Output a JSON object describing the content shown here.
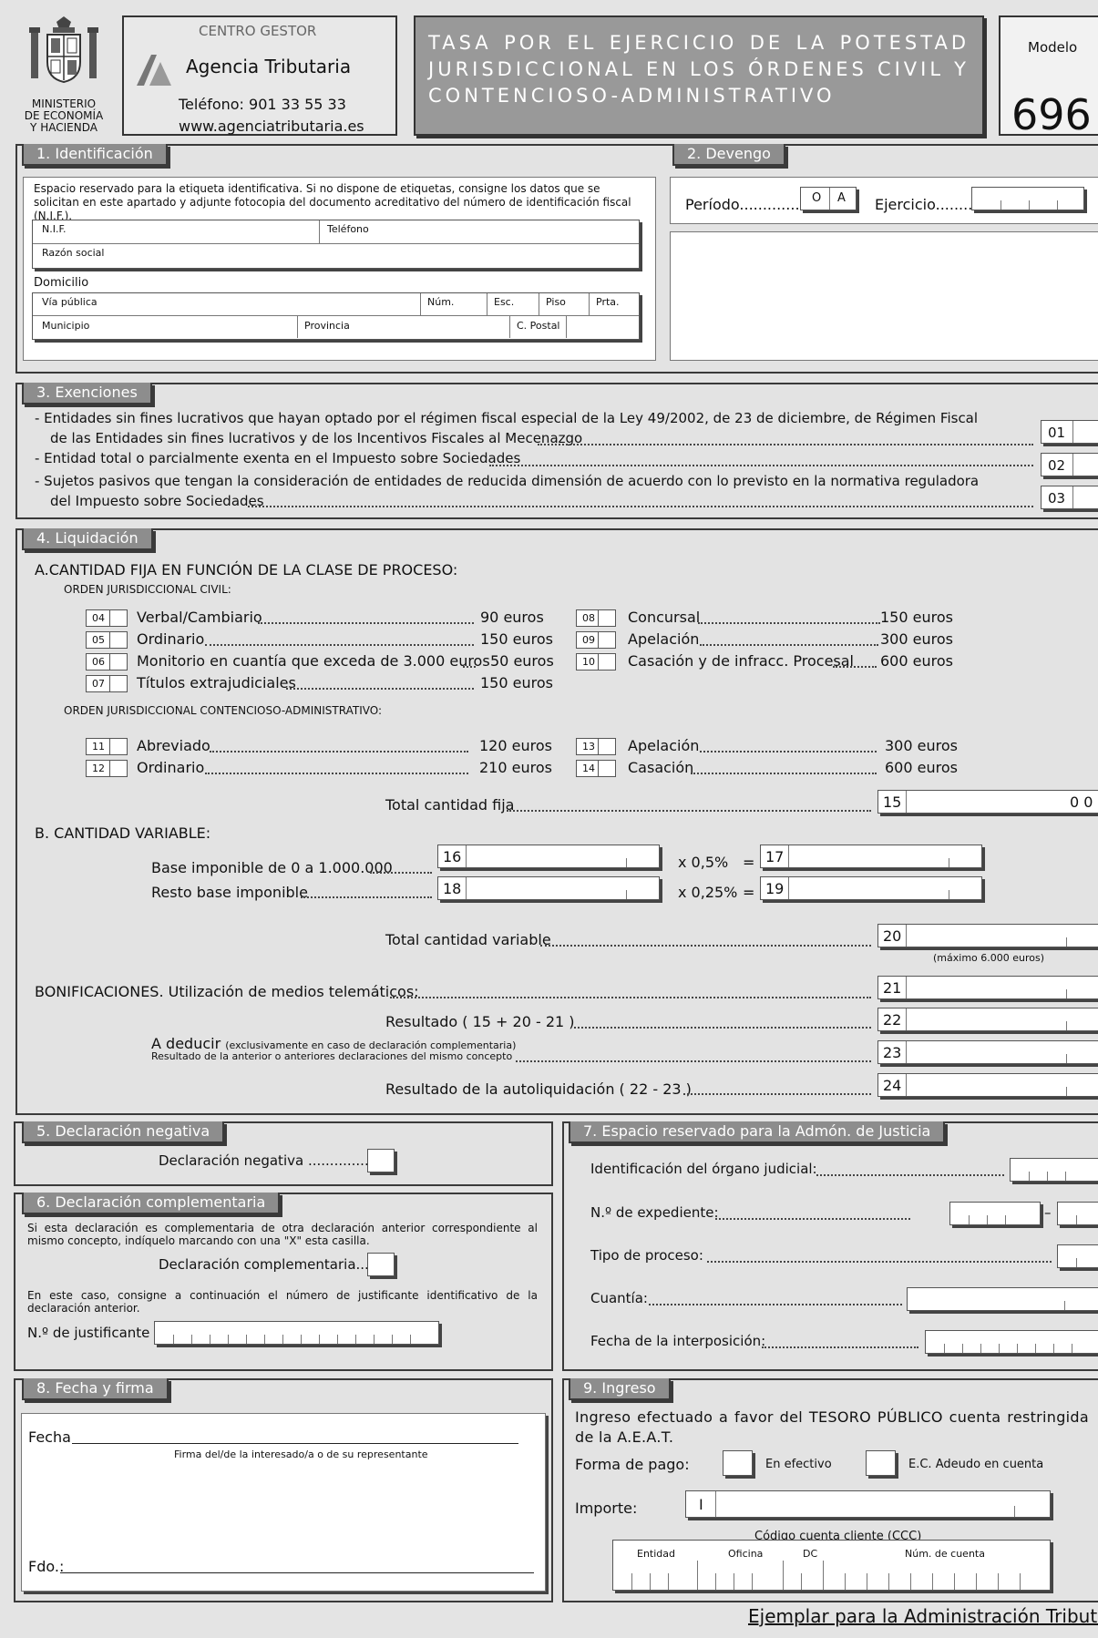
{
  "header": {
    "ministry": [
      "MINISTERIO",
      "DE ECONOMÍA",
      "Y HACIENDA"
    ],
    "centro_gestor": "CENTRO GESTOR",
    "agency_name": "Agencia Tributaria",
    "telefono": "Teléfono: 901 33 55 33",
    "web": "www.agenciatributaria.es",
    "title": "TASA POR EL EJERCICIO DE LA POTESTAD JURISDICCIONAL EN LOS ÓRDENES CIVIL Y CONTENCIOSO-ADMINISTRATIVO",
    "modelo_label": "Modelo",
    "modelo_number": "696"
  },
  "s1": {
    "tab": "1.  Identificación",
    "note": "Espacio reservado para la etiqueta identificativa. Si no dispone de etiquetas, consigne los datos que se solicitan en este apartado y adjunte fotocopia del documento acreditativo del número de identificación fiscal (N.I.F.).",
    "nif": "N.I.F.",
    "telefono": "Teléfono",
    "razon": "Razón social",
    "domicilio": "Domicilio",
    "via": "Vía pública",
    "num": "Núm.",
    "esc": "Esc.",
    "piso": "Piso",
    "prta": "Prta.",
    "municipio": "Municipio",
    "provincia": "Provincia",
    "cpostal": "C. Postal"
  },
  "s2": {
    "tab": "2.  Devengo",
    "periodo": "Período",
    "periodo_value_o": "O",
    "periodo_value_a": "A",
    "ejercicio": "Ejercicio"
  },
  "s3": {
    "tab": "3.  Exenciones",
    "items": [
      {
        "line1": "-  Entidades sin fines lucrativos que hayan optado por el régimen fiscal especial de la Ley 49/2002, de 23 de diciembre, de Régimen Fiscal",
        "line2": "de las Entidades sin fines lucrativos y de los Incentivos Fiscales al Mecenazgo",
        "code": "01"
      },
      {
        "line1": "-  Entidad total o parcialmente exenta en el Impuesto sobre Sociedades",
        "line2": "",
        "code": "02"
      },
      {
        "line1": "-  Sujetos pasivos que tengan la consideración de entidades de reducida dimensión de acuerdo con lo previsto en la normativa reguladora",
        "line2": "del Impuesto sobre Sociedades",
        "code": "03"
      }
    ]
  },
  "s4": {
    "tab": "4.  Liquidación",
    "a_title": "A.CANTIDAD FIJA EN FUNCIÓN DE LA CLASE DE PROCESO:",
    "civil": "ORDEN JURISDICCIONAL CIVIL:",
    "contencioso": "ORDEN JURISDICCIONAL CONTENCIOSO-ADMINISTRATIVO:",
    "civil_left": [
      {
        "code": "04",
        "label": "Verbal/Cambiario",
        "amount": "90 euros"
      },
      {
        "code": "05",
        "label": "Ordinario",
        "amount": "150 euros"
      },
      {
        "code": "06",
        "label": "Monitorio en cuantía que exceda de 3.000 euros",
        "amount": "50 euros"
      },
      {
        "code": "07",
        "label": "Títulos extrajudiciales",
        "amount": "150 euros"
      }
    ],
    "civil_right": [
      {
        "code": "08",
        "label": "Concursal",
        "amount": "150 euros"
      },
      {
        "code": "09",
        "label": "Apelación",
        "amount": "300 euros"
      },
      {
        "code": "10",
        "label": "Casación y de infracc. Procesal",
        "amount": "600 euros"
      }
    ],
    "cont_left": [
      {
        "code": "11",
        "label": "Abreviado",
        "amount": "120 euros"
      },
      {
        "code": "12",
        "label": "Ordinario",
        "amount": "210 euros"
      }
    ],
    "cont_right": [
      {
        "code": "13",
        "label": "Apelación",
        "amount": "300 euros"
      },
      {
        "code": "14",
        "label": "Casación",
        "amount": "600 euros"
      }
    ],
    "total_fija": "Total cantidad fija",
    "box15": "15",
    "box15_value": "0 0",
    "b_title": "B. CANTIDAD VARIABLE:",
    "base1": "Base imponible de 0 a 1.000.000",
    "base2": "Resto base imponible",
    "box16": "16",
    "box17": "17",
    "box18": "18",
    "box19": "19",
    "rate1": "x 0,5%",
    "rate2": "x 0,25%",
    "eq": "=",
    "total_var": "Total cantidad variable",
    "box20": "20",
    "maximo": "(máximo 6.000 euros)",
    "bonif": "BONIFICACIONES. Utilización de medios telemáticos:",
    "box21": "21",
    "resultado": "Resultado ( 15 + 20 - 21 )",
    "box22": "22",
    "deducir": "A deducir",
    "deducir_note": "(exclusivamente en caso de declaración complementaria)",
    "deducir_sub": "Resultado de la anterior o anteriores declaraciones del mismo concepto",
    "box23": "23",
    "autoliq": "Resultado de la autoliquidación ( 22 - 23 )",
    "box24": "24"
  },
  "s5": {
    "tab": "5.  Declaración negativa",
    "label": "Declaración negativa"
  },
  "s6": {
    "tab": "6.  Declaración complementaria",
    "note1": "Si esta declaración es complementaria de otra declaración anterior correspondiente al mismo concepto, indíquelo marcando con una \"X\" esta casilla.",
    "label": "Declaración complementaria",
    "note2": "En este caso, consigne a continuación el número de justificante identificativo de la declaración anterior.",
    "justificante": "N.º de justificante"
  },
  "s7": {
    "tab": "7.  Espacio reservado para la Admón. de Justicia",
    "organo": "Identificación del órgano judicial:",
    "expediente": "N.º de expediente:",
    "dash": "–",
    "tipo": "Tipo de proceso:",
    "cuantia": "Cuantía:",
    "fecha": "Fecha de la interposición:"
  },
  "s8": {
    "tab": "8.  Fecha y firma",
    "fecha": "Fecha",
    "firma": "Firma del/de la interesado/a o de su representante",
    "fdo": "Fdo.:"
  },
  "s9": {
    "tab": "9.  Ingreso",
    "text": "Ingreso efectuado a favor del TESORO PÚBLICO cuenta restringida de la A.E.A.T.",
    "forma": "Forma de pago:",
    "efectivo": "En efectivo",
    "adeudo": "E.C. Adeudo en cuenta",
    "importe": "Importe:",
    "importe_value": "I",
    "ccc": "Código cuenta cliente (CCC)",
    "entidad": "Entidad",
    "oficina": "Oficina",
    "dc": "DC",
    "cuenta": "Núm. de cuenta"
  },
  "footer": "Ejemplar para la Administración Tributaria"
}
